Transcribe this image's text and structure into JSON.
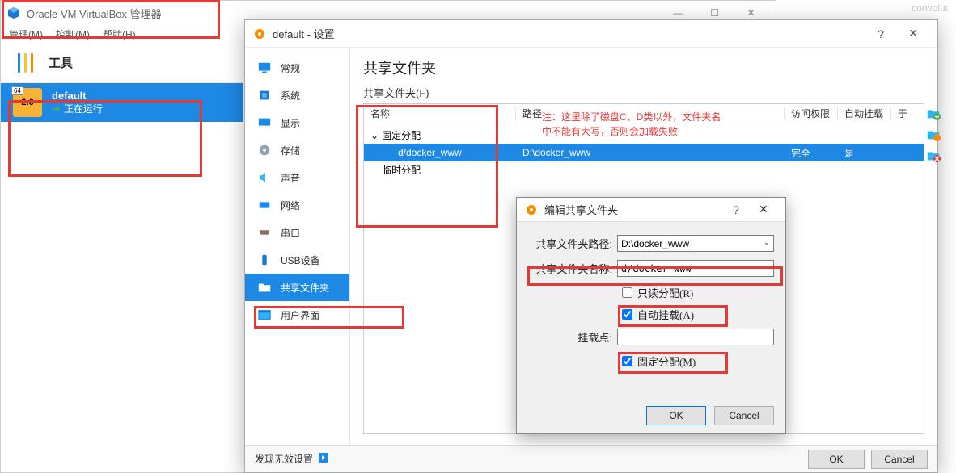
{
  "vbox": {
    "title": "Oracle VM VirtualBox 管理器",
    "menu": {
      "manage": "管理(M)",
      "control": "控制(M)",
      "help": "帮助(H)"
    },
    "tools_label": "工具",
    "vm": {
      "badge": "64",
      "version": "2.6",
      "name": "default",
      "status": "正在运行"
    },
    "win": {
      "min": "—",
      "max": "☐",
      "close": "✕"
    }
  },
  "settings": {
    "title": "default - 设置",
    "help": "?",
    "close": "✕",
    "categories": {
      "general": "常规",
      "system": "系统",
      "display": "显示",
      "storage": "存储",
      "audio": "声音",
      "network": "网络",
      "serial": "串口",
      "usb": "USB设备",
      "shared": "共享文件夹",
      "ui": "用户界面"
    },
    "content": {
      "title": "共享文件夹",
      "subtitle": "共享文件夹(F)",
      "cols": {
        "name": "名称",
        "path": "路径",
        "access": "访问权限",
        "auto": "自动挂载",
        "at": "于"
      },
      "group_fixed": "固定分配",
      "group_temp": "临时分配",
      "row": {
        "name": "d/docker_www",
        "path": "D:\\docker_www",
        "access": "完全",
        "auto": "是"
      }
    },
    "footer": {
      "text": "发现无效设置",
      "ok": "OK",
      "cancel": "Cancel"
    }
  },
  "edit": {
    "title": "编辑共享文件夹",
    "help": "?",
    "close": "✕",
    "labels": {
      "path": "共享文件夹路径:",
      "name": "共享文件夹名称:",
      "readonly": "只读分配(R)",
      "automount": "自动挂载(A)",
      "mountpoint": "挂载点:",
      "permanent": "固定分配(M)"
    },
    "values": {
      "path": "D:\\docker_www",
      "name": "d/docker_www",
      "mountpoint": ""
    },
    "checks": {
      "readonly": false,
      "automount": true,
      "permanent": true
    },
    "ok": "OK",
    "cancel": "Cancel"
  },
  "annotation": {
    "line1": "注：这里除了磁盘C、D类以外，文件夹名",
    "line2": "中不能有大写，否则会加载失败"
  },
  "faded_right": "convolut"
}
